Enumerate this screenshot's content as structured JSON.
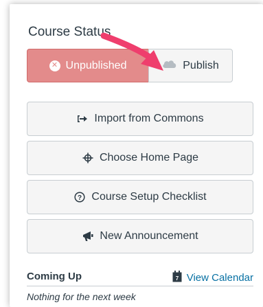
{
  "course_status": {
    "title": "Course Status",
    "unpublished_label": "Unpublished",
    "publish_label": "Publish"
  },
  "actions": [
    {
      "label": "Import from Commons"
    },
    {
      "label": "Choose Home Page"
    },
    {
      "label": "Course Setup Checklist"
    },
    {
      "label": "New Announcement"
    }
  ],
  "coming_up": {
    "title": "Coming Up",
    "calendar_link": "View Calendar",
    "empty_text": "Nothing for the next week"
  },
  "colors": {
    "unpublished_bg": "#e38b8b",
    "button_bg": "#f5f5f5",
    "link": "#0770a3",
    "annotation_arrow": "#ef3e6d"
  },
  "icons": {
    "unpublished": "x-circle-icon",
    "publish": "cloud-icon",
    "import": "import-arrow-icon",
    "home": "crosshair-icon",
    "checklist": "question-circle-icon",
    "announcement": "megaphone-icon",
    "calendar": "calendar-icon"
  }
}
